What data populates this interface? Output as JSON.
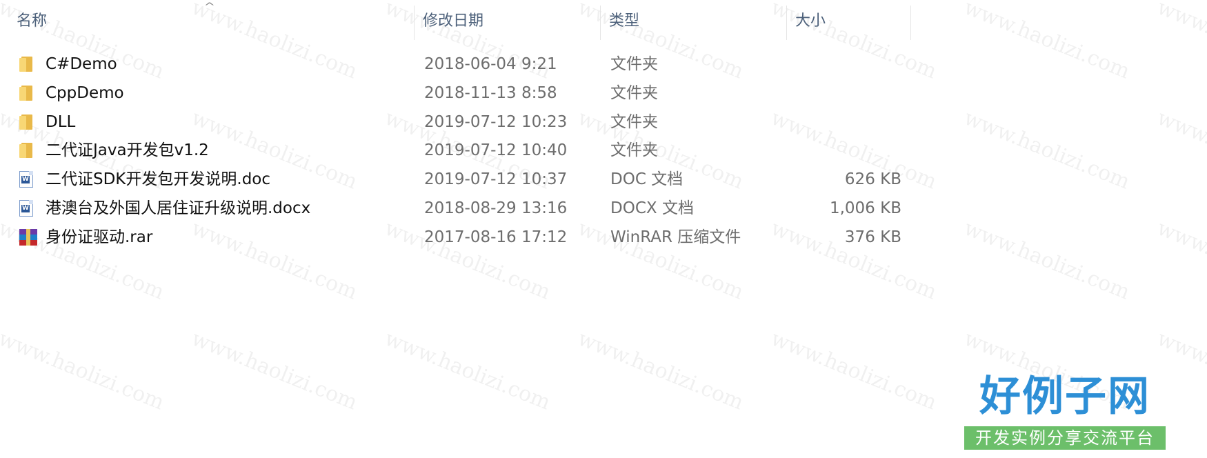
{
  "columns": {
    "name": "名称",
    "date": "修改日期",
    "type": "类型",
    "size": "大小"
  },
  "files": [
    {
      "icon": "folder-icon",
      "name": "C#Demo",
      "date": "2018-06-04 9:21",
      "type": "文件夹",
      "size": ""
    },
    {
      "icon": "folder-icon",
      "name": "CppDemo",
      "date": "2018-11-13 8:58",
      "type": "文件夹",
      "size": ""
    },
    {
      "icon": "folder-icon",
      "name": "DLL",
      "date": "2019-07-12 10:23",
      "type": "文件夹",
      "size": ""
    },
    {
      "icon": "folder-icon",
      "name": "二代证Java开发包v1.2",
      "date": "2019-07-12 10:40",
      "type": "文件夹",
      "size": ""
    },
    {
      "icon": "word-doc-icon",
      "name": "二代证SDK开发包开发说明.doc",
      "date": "2019-07-12 10:37",
      "type": "DOC 文档",
      "size": "626 KB"
    },
    {
      "icon": "word-doc-icon",
      "name": "港澳台及外国人居住证升级说明.docx",
      "date": "2018-08-29 13:16",
      "type": "DOCX 文档",
      "size": "1,006 KB"
    },
    {
      "icon": "winrar-icon",
      "name": "身份证驱动.rar",
      "date": "2017-08-16 17:12",
      "type": "WinRAR 压缩文件",
      "size": "376 KB"
    }
  ],
  "watermark": "www.haolizi.com",
  "logo": {
    "title": "好例子网",
    "subtitle": "开发实例分享交流平台"
  },
  "colors": {
    "header_text": "#4c607a",
    "folder": "#f8d775",
    "logo_blue": "#2d8fd6",
    "logo_green": "#6cbf6a"
  }
}
